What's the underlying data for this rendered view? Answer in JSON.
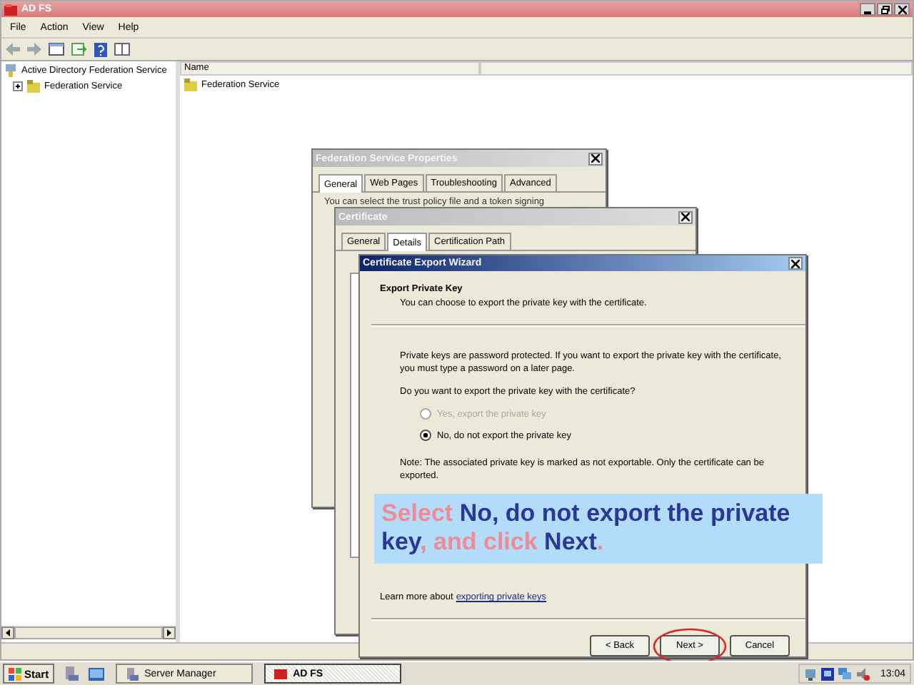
{
  "main_window": {
    "title": "AD FS",
    "menu": [
      "File",
      "Action",
      "View",
      "Help"
    ],
    "tree": [
      {
        "label": "Active Directory Federation Service",
        "children": [
          {
            "label": "Federation Service",
            "expanded": false
          }
        ]
      }
    ],
    "list": {
      "columns": [
        "Name"
      ],
      "rows": [
        "Federation Service"
      ]
    }
  },
  "properties_dialog": {
    "title": "Federation Service Properties",
    "tabs": [
      {
        "label": "General",
        "selected": true
      },
      {
        "label": "Web Pages",
        "selected": false
      },
      {
        "label": "Troubleshooting",
        "selected": false
      },
      {
        "label": "Advanced",
        "selected": false
      }
    ],
    "text": "You can select the trust policy file and a token signing"
  },
  "certificate_dialog": {
    "title": "Certificate",
    "tabs": [
      {
        "label": "General",
        "selected": false
      },
      {
        "label": "Details",
        "selected": true
      },
      {
        "label": "Certification Path",
        "selected": false
      }
    ]
  },
  "wizard": {
    "title": "Certificate Export Wizard",
    "heading": "Export Private Key",
    "subheading": "You can choose to export the private key with the certificate.",
    "description": "Private keys are password protected. If you want to export the private key with the certificate, you must type a password on a later page.",
    "question": "Do you want to export the private key with the certificate?",
    "options": [
      {
        "label": "Yes, export the private key",
        "selected": false,
        "disabled": true
      },
      {
        "label": "No, do not export the private key",
        "selected": true,
        "disabled": false
      }
    ],
    "note": "Note: The associated private key is marked as not exportable. Only the certificate can be exported.",
    "learn_more": {
      "text": "Learn more about",
      "link": "exporting private keys"
    },
    "buttons": [
      {
        "label": "< Back",
        "circled": false
      },
      {
        "label": "Next >",
        "circled": true
      },
      {
        "label": "Cancel",
        "circled": false
      }
    ]
  },
  "callout": {
    "parts": [
      {
        "text": "Select ",
        "highlight": false
      },
      {
        "text": "No, do not export the private key",
        "highlight": true
      },
      {
        "text": ", and click ",
        "highlight": false
      },
      {
        "text": "Next",
        "highlight": true
      },
      {
        "text": ".",
        "highlight": false
      }
    ]
  },
  "taskbar": {
    "start": "Start",
    "tasks": [
      {
        "label": "Server Manager",
        "selected": false
      },
      {
        "label": "AD FS",
        "selected": true
      }
    ],
    "clock": "13:04"
  }
}
